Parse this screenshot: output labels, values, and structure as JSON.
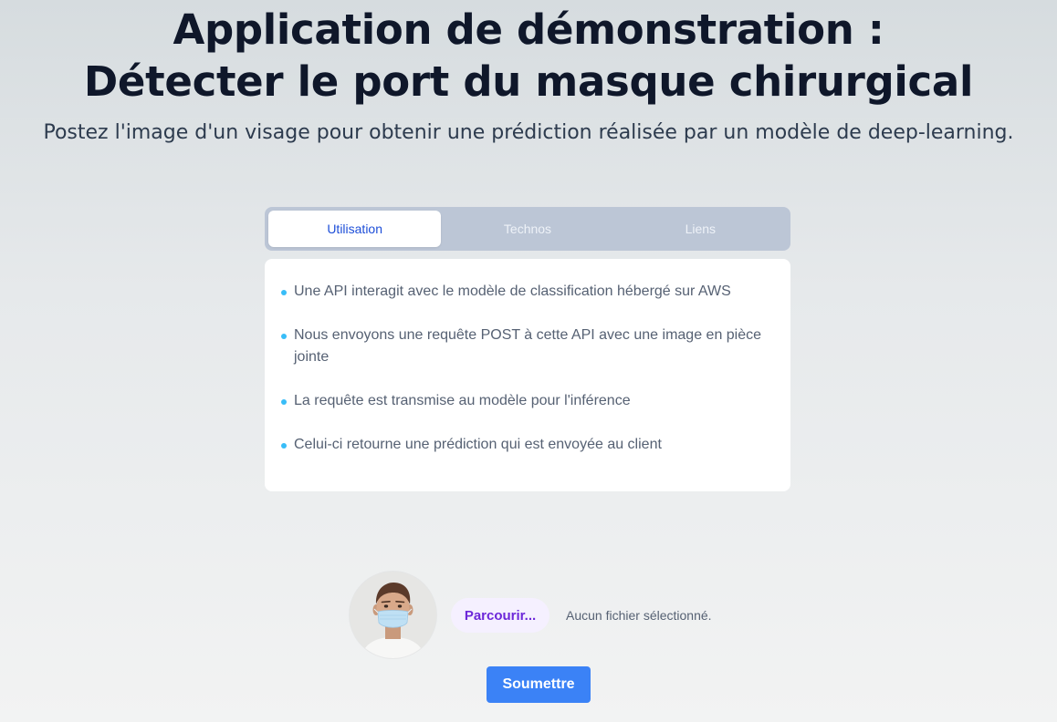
{
  "header": {
    "title_line1": "Application de démonstration :",
    "title_line2": "Détecter le port du masque chirurgical",
    "subtitle": "Postez l'image d'un visage pour obtenir une prédiction réalisée par un modèle de deep-learning."
  },
  "tabs": [
    {
      "label": "Utilisation",
      "active": true
    },
    {
      "label": "Technos",
      "active": false
    },
    {
      "label": "Liens",
      "active": false
    }
  ],
  "panel": {
    "items": [
      "Une API interagit avec le modèle de classification hébergé sur AWS",
      "Nous envoyons une requête POST à cette API avec une image en pièce jointe",
      "La requête est transmise au modèle pour l'inférence",
      "Celui-ci retourne une prédiction qui est envoyée au client"
    ]
  },
  "upload": {
    "avatar_icon": "masked-face-avatar",
    "browse_label": "Parcourir...",
    "file_status": "Aucun fichier sélectionné.",
    "submit_label": "Soumettre"
  },
  "colors": {
    "accent": "#3b82f6",
    "tab_active_text": "#1d4ed8",
    "bullet": "#38bdf8",
    "browse_text": "#6d28d9"
  }
}
